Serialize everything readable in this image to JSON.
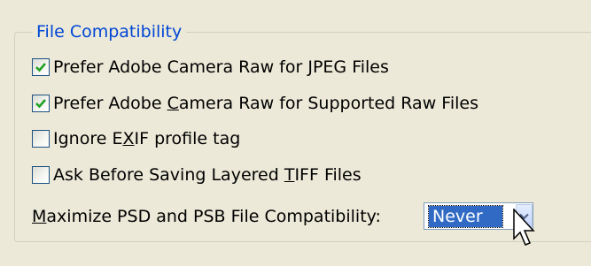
{
  "group": {
    "title": "File Compatibility"
  },
  "options": [
    {
      "label_pre": "Prefer Adobe Camera Raw for ",
      "label_accel": "J",
      "label_post": "PEG Files",
      "checked": true
    },
    {
      "label_pre": "Prefer Adobe ",
      "label_accel": "C",
      "label_post": "amera Raw for Supported Raw Files",
      "checked": true
    },
    {
      "label_pre": "Ignore E",
      "label_accel": "X",
      "label_post": "IF profile tag",
      "checked": false
    },
    {
      "label_pre": "Ask Before Saving Layered ",
      "label_accel": "T",
      "label_post": "IFF Files",
      "checked": false
    }
  ],
  "maximize": {
    "label_accel": "M",
    "label_post": "aximize PSD and PSB File Compatibility:",
    "selected": "Never"
  },
  "icons": {
    "check": "checkmark-icon",
    "dropdown": "chevron-down-icon",
    "cursor": "mouse-pointer-icon"
  },
  "colors": {
    "background": "#ece9d8",
    "legend": "#0046d5",
    "check": "#21a121",
    "selection": "#316ac5"
  }
}
